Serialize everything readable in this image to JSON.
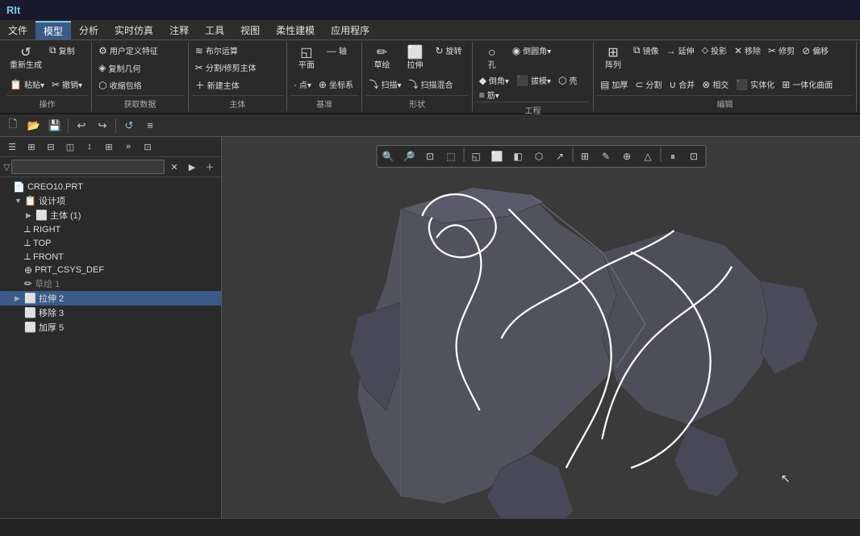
{
  "title": "RIt",
  "menu": {
    "items": [
      {
        "label": "文件",
        "active": false
      },
      {
        "label": "模型",
        "active": true
      },
      {
        "label": "分析",
        "active": false
      },
      {
        "label": "实时仿真",
        "active": false
      },
      {
        "label": "注释",
        "active": false
      },
      {
        "label": "工具",
        "active": false
      },
      {
        "label": "视图",
        "active": false
      },
      {
        "label": "柔性建模",
        "active": false
      },
      {
        "label": "应用程序",
        "active": false
      }
    ]
  },
  "ribbon": {
    "groups": [
      {
        "label": "操作",
        "buttons": [
          {
            "icon": "↺",
            "label": "重新生成",
            "type": "large"
          },
          {
            "icon": "⧉",
            "label": "复制",
            "type": "small"
          },
          {
            "icon": "📋",
            "label": "粘贴▾",
            "type": "small"
          },
          {
            "icon": "✂",
            "label": "撤销▾",
            "type": "small"
          }
        ]
      },
      {
        "label": "获取数据",
        "buttons": [
          {
            "icon": "⚙",
            "label": "用户定义特征",
            "type": "small"
          },
          {
            "icon": "◈",
            "label": "复制几何",
            "type": "small"
          },
          {
            "icon": "⬡",
            "label": "收缩包络",
            "type": "small"
          }
        ]
      },
      {
        "label": "主体",
        "buttons": [
          {
            "icon": "≋",
            "label": "布尔运算",
            "type": "small"
          },
          {
            "icon": "✂",
            "label": "分割/修剪主体",
            "type": "small"
          },
          {
            "icon": "＋",
            "label": "新建主体",
            "type": "small"
          }
        ]
      },
      {
        "label": "基准",
        "buttons": [
          {
            "icon": "◱",
            "label": "平面",
            "type": "medium"
          },
          {
            "icon": "—",
            "label": "轴",
            "type": "small"
          },
          {
            "icon": "·",
            "label": "点▾",
            "type": "small"
          },
          {
            "icon": "⊕",
            "label": "坐标系",
            "type": "small"
          }
        ]
      },
      {
        "label": "形状",
        "buttons": [
          {
            "icon": "✏",
            "label": "草绘",
            "type": "medium"
          },
          {
            "icon": "⬜",
            "label": "拉伸",
            "type": "medium"
          },
          {
            "icon": "↻",
            "label": "旋转",
            "type": "small"
          },
          {
            "icon": "⤵",
            "label": "扫描▾",
            "type": "small"
          },
          {
            "icon": "⤵",
            "label": "扫描混合",
            "type": "small"
          }
        ]
      },
      {
        "label": "工程",
        "buttons": [
          {
            "icon": "○",
            "label": "孔",
            "type": "medium"
          },
          {
            "icon": "◉",
            "label": "倒圆角▾",
            "type": "small"
          },
          {
            "icon": "◆",
            "label": "倒角▾",
            "type": "small"
          },
          {
            "icon": "⬛",
            "label": "拔模▾",
            "type": "small"
          },
          {
            "icon": "⬡",
            "label": "壳",
            "type": "small"
          },
          {
            "icon": "≡",
            "label": "筋▾",
            "type": "small"
          }
        ]
      },
      {
        "label": "编辑",
        "buttons": [
          {
            "icon": "⊞",
            "label": "阵列",
            "type": "medium"
          },
          {
            "icon": "⧉",
            "label": "镜像",
            "type": "small"
          },
          {
            "icon": "→",
            "label": "延伸",
            "type": "small"
          },
          {
            "icon": "⬦",
            "label": "投影",
            "type": "small"
          },
          {
            "icon": "✕",
            "label": "移除",
            "type": "small"
          },
          {
            "icon": "✂",
            "label": "修剪",
            "type": "small"
          },
          {
            "icon": "⊘",
            "label": "偏移",
            "type": "small"
          },
          {
            "icon": "▤",
            "label": "加厚",
            "type": "small"
          },
          {
            "icon": "⊂",
            "label": "分割",
            "type": "small"
          },
          {
            "icon": "∪",
            "label": "合并",
            "type": "small"
          },
          {
            "icon": "⊗",
            "label": "相交",
            "type": "small"
          },
          {
            "icon": "⬛",
            "label": "实体化",
            "type": "small"
          },
          {
            "icon": "⊞",
            "label": "一体化曲面",
            "type": "small"
          }
        ]
      }
    ]
  },
  "sidebar_toolbar": {
    "buttons": [
      {
        "icon": "☰",
        "label": "list-view"
      },
      {
        "icon": "⊞",
        "label": "grid-view"
      },
      {
        "icon": "⊟",
        "label": "collapse"
      },
      {
        "icon": "◫",
        "label": "panel"
      },
      {
        "icon": "↕",
        "label": "sort"
      },
      {
        "icon": "⊞",
        "label": "columns"
      },
      {
        "icon": "»",
        "label": "more"
      },
      {
        "icon": "⊡",
        "label": "options"
      }
    ]
  },
  "search": {
    "placeholder": "",
    "value": ""
  },
  "tree": {
    "items": [
      {
        "id": "root",
        "label": "CREO10.PRT",
        "indent": 0,
        "icon": "📄",
        "arrow": "",
        "type": "file"
      },
      {
        "id": "design",
        "label": "设计项",
        "indent": 1,
        "icon": "📋",
        "arrow": "▼",
        "type": "folder"
      },
      {
        "id": "body1",
        "label": "主体 (1)",
        "indent": 2,
        "icon": "⬜",
        "arrow": "▶",
        "type": "body"
      },
      {
        "id": "right",
        "label": "RIGHT",
        "indent": 1,
        "icon": "⟂",
        "arrow": "",
        "type": "plane"
      },
      {
        "id": "top",
        "label": "TOP",
        "indent": 1,
        "icon": "⟂",
        "arrow": "",
        "type": "plane"
      },
      {
        "id": "front",
        "label": "FRONT",
        "indent": 1,
        "icon": "⟂",
        "arrow": "",
        "type": "plane"
      },
      {
        "id": "csys",
        "label": "PRT_CSYS_DEF",
        "indent": 1,
        "icon": "⊕",
        "arrow": "",
        "type": "csys"
      },
      {
        "id": "sketch1",
        "label": "草绘 1",
        "indent": 1,
        "icon": "✏",
        "arrow": "",
        "type": "sketch",
        "dimmed": true
      },
      {
        "id": "extrude2",
        "label": "拉伸 2",
        "indent": 1,
        "icon": "⬜",
        "arrow": "▶",
        "type": "extrude"
      },
      {
        "id": "remove3",
        "label": "移除 3",
        "indent": 1,
        "icon": "⬜",
        "arrow": "",
        "type": "remove"
      },
      {
        "id": "thicken5",
        "label": "加厚 5",
        "indent": 1,
        "icon": "⬜",
        "arrow": "",
        "type": "thicken"
      }
    ]
  },
  "viewport": {
    "toolbar_buttons": [
      {
        "icon": "🔍",
        "label": "zoom-in"
      },
      {
        "icon": "🔎",
        "label": "zoom-out"
      },
      {
        "icon": "⊡",
        "label": "zoom-fit"
      },
      {
        "icon": "⬚",
        "label": "view-options"
      },
      {
        "icon": "◱",
        "label": "plane-display"
      },
      {
        "icon": "⬜",
        "label": "shading"
      },
      {
        "icon": "◧",
        "label": "half-view"
      },
      {
        "icon": "⬡",
        "label": "mesh"
      },
      {
        "icon": "↗",
        "label": "perspective"
      },
      {
        "icon": "⊞",
        "label": "grid"
      },
      {
        "icon": "✎",
        "label": "sketch-display"
      },
      {
        "icon": "⊕",
        "label": "csys-display"
      },
      {
        "icon": "△",
        "label": "normal-display"
      },
      {
        "icon": "⏸",
        "label": "pause"
      },
      {
        "icon": "⊡",
        "label": "settings"
      }
    ]
  },
  "status_bar": {
    "text": ""
  },
  "colors": {
    "bg_dark": "#2a2a2a",
    "bg_viewport": "#3a3a3a",
    "accent": "#7ec8e3",
    "model_fill": "#5a5a6a",
    "model_stroke": "#ffffff",
    "active_tab": "#3a5a8a"
  }
}
